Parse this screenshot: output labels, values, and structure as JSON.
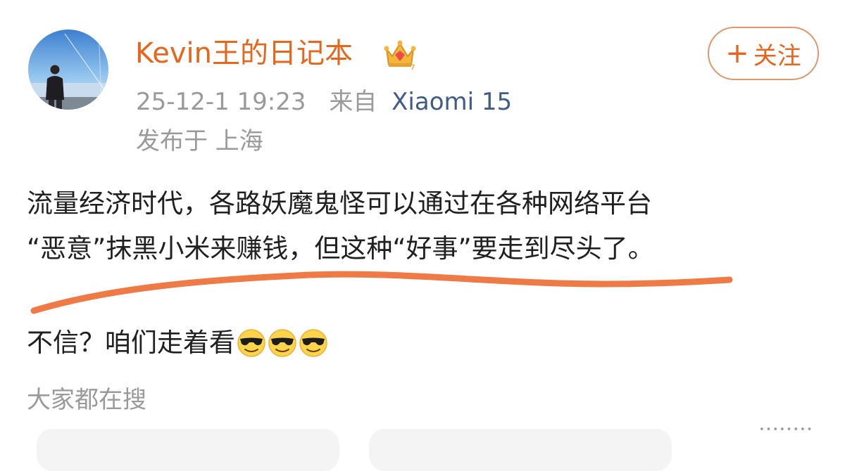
{
  "post": {
    "author": {
      "name": "Kevin王的日记本",
      "badge_icon": "crown-icon"
    },
    "follow_label": "关注",
    "meta": {
      "time": "25-12-1 19:23",
      "source_prefix": "来自",
      "source_device": "Xiaomi 15",
      "location": "发布于 上海"
    },
    "body_lines": [
      "流量经济时代，各路妖魔鬼怪可以通过在各种网络平台",
      "“恶意”抹黑小米来赚钱，但这种“好事”要走到尽头了。"
    ],
    "followup": "不信？咱们走着看",
    "followup_emoji": [
      "cool-emoji",
      "cool-emoji",
      "cool-emoji"
    ]
  },
  "search": {
    "heading": "大家都在搜"
  },
  "watermark": "••••••••",
  "colors": {
    "author_name": "#e8661b",
    "follow_accent": "#e8661b",
    "follow_border": "#e0976a",
    "underline_stroke": "#f07a45",
    "meta_gray": "#9a9a9a",
    "device_link": "#3f5b86"
  }
}
